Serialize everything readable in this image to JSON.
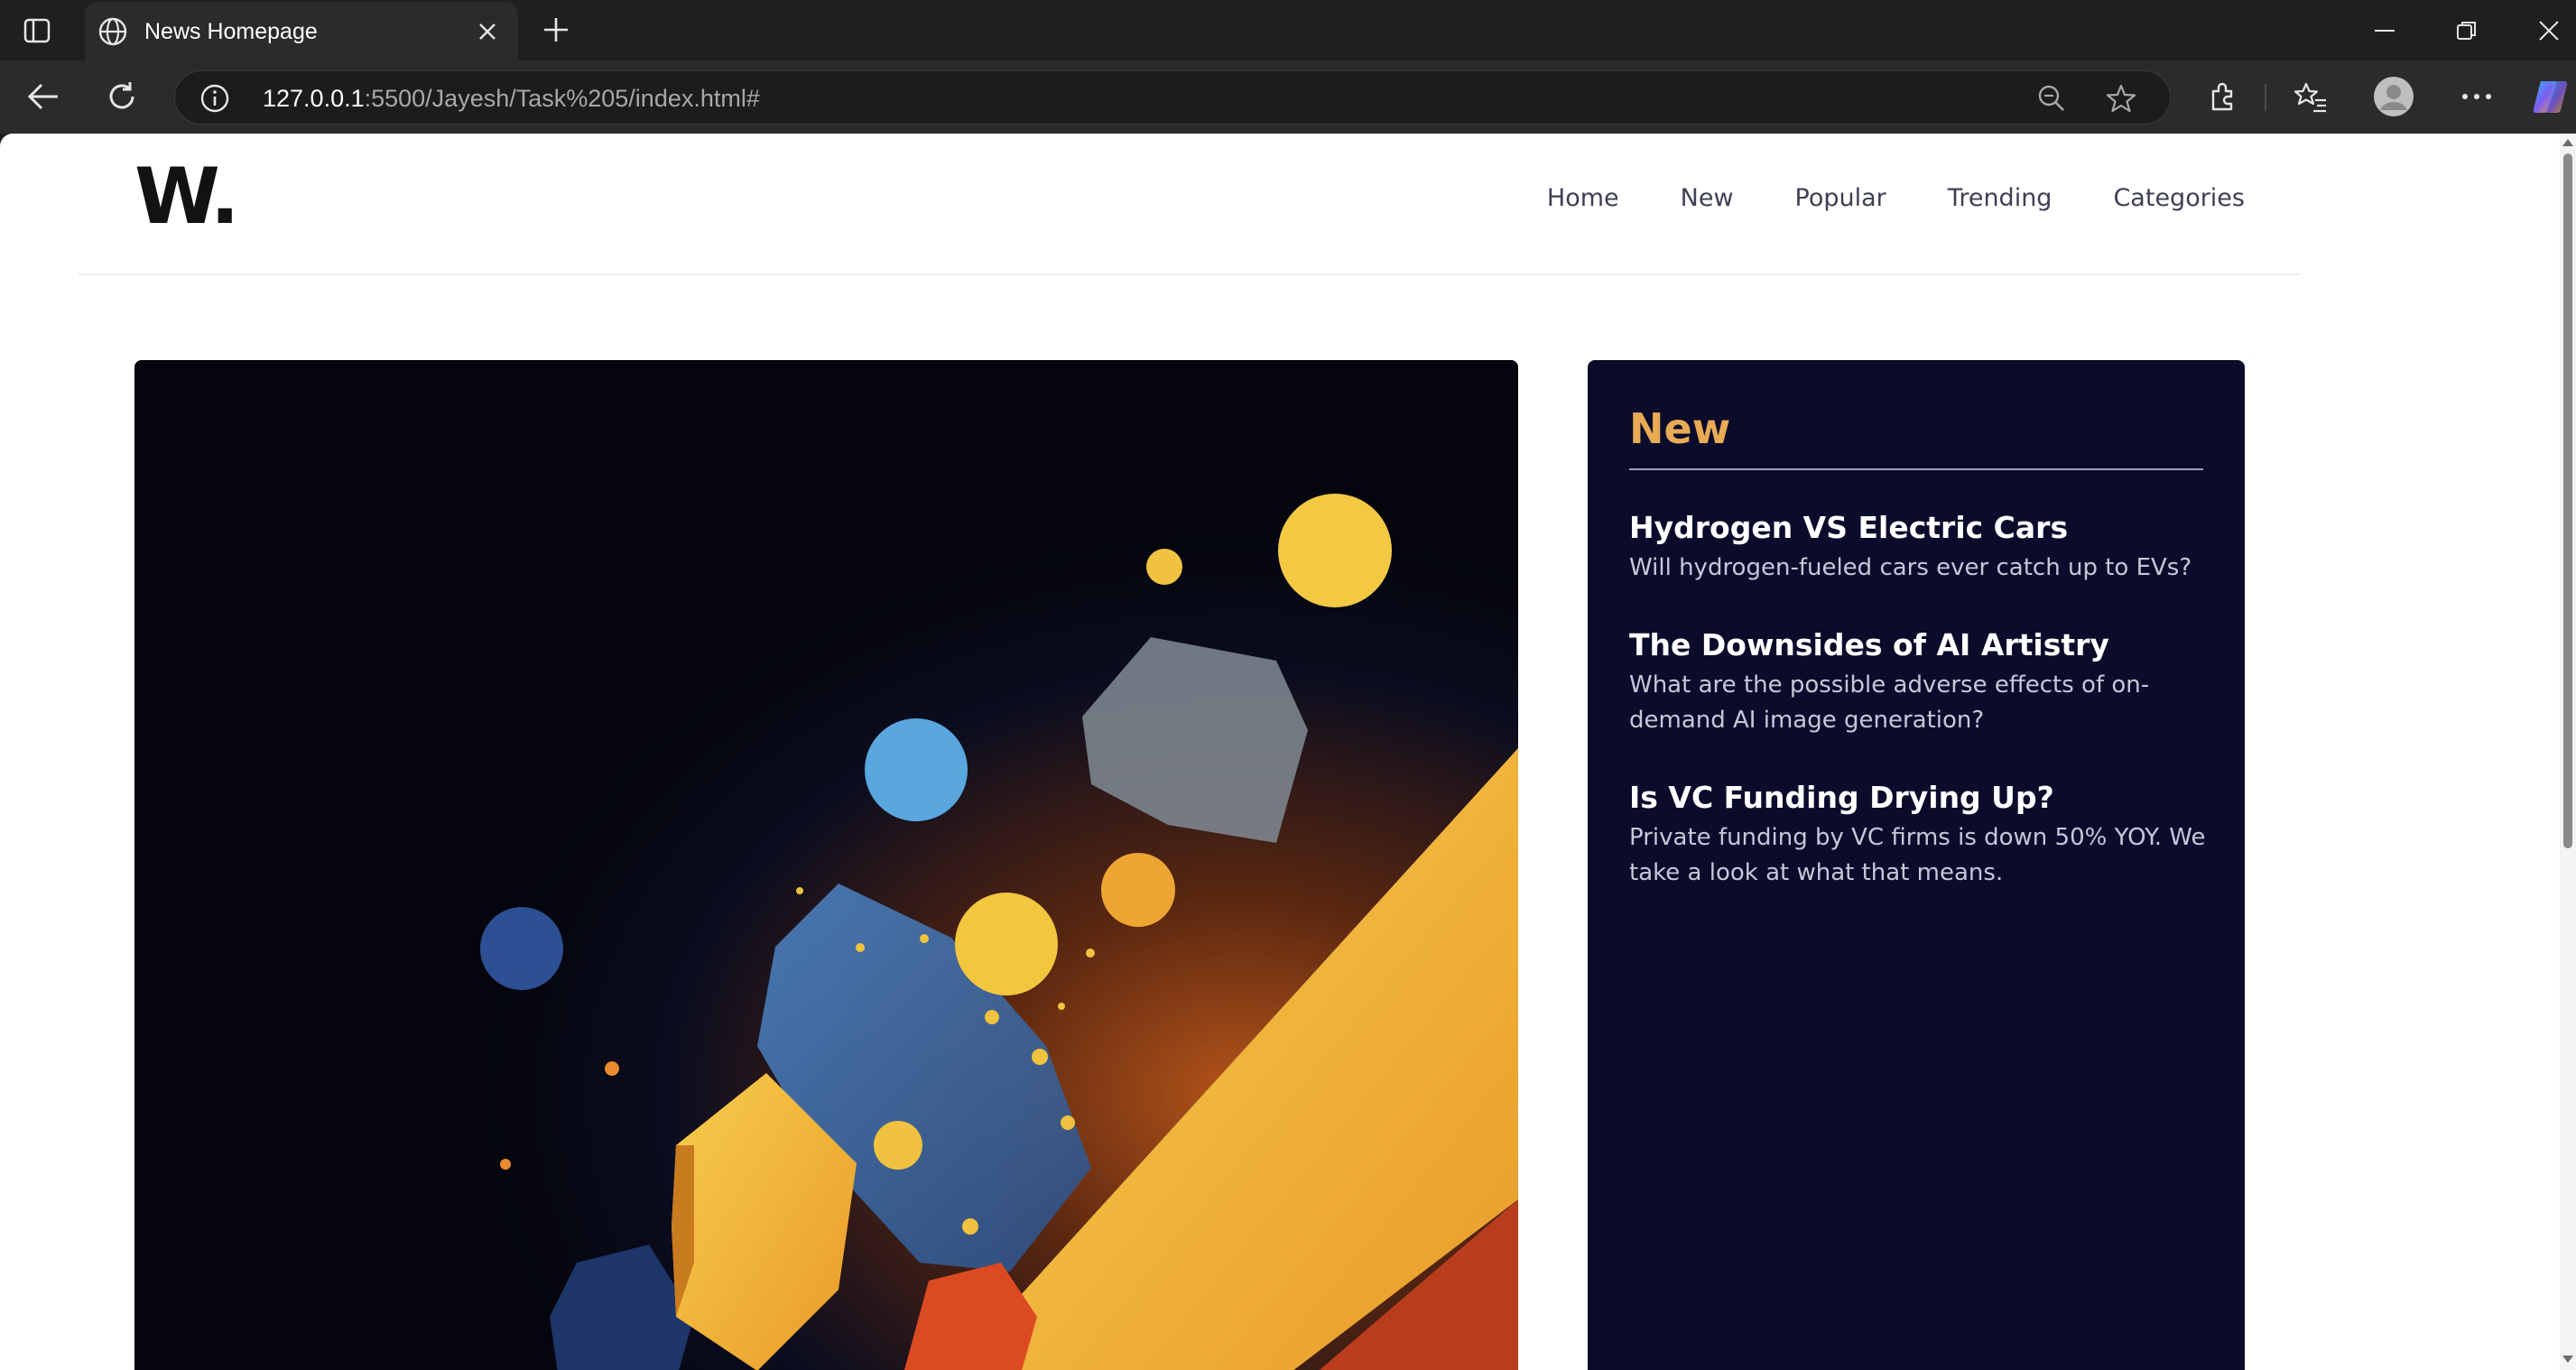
{
  "browser": {
    "tab_title": "News Homepage",
    "url_host": "127.0.0.1",
    "url_path": ":5500/Jayesh/Task%205/index.html#",
    "colors": {
      "tabbar": "#1f1f1f",
      "toolbar": "#2b2b2b"
    }
  },
  "site": {
    "logo": "W.",
    "nav": [
      "Home",
      "New",
      "Popular",
      "Trending",
      "Categories"
    ]
  },
  "new_panel": {
    "heading": "New",
    "items": [
      {
        "title": "Hydrogen VS Electric Cars",
        "desc": "Will hydrogen-fueled cars ever catch up to EVs?"
      },
      {
        "title": "The Downsides of AI Artistry",
        "desc": "What are the possible adverse effects of on-demand AI image generation?"
      },
      {
        "title": "Is VC Funding Drying Up?",
        "desc": "Private funding by VC firms is down 50% YOY. We take a look at what that means."
      }
    ],
    "colors": {
      "background": "#0b0c2c",
      "heading": "#e9ab53"
    }
  }
}
